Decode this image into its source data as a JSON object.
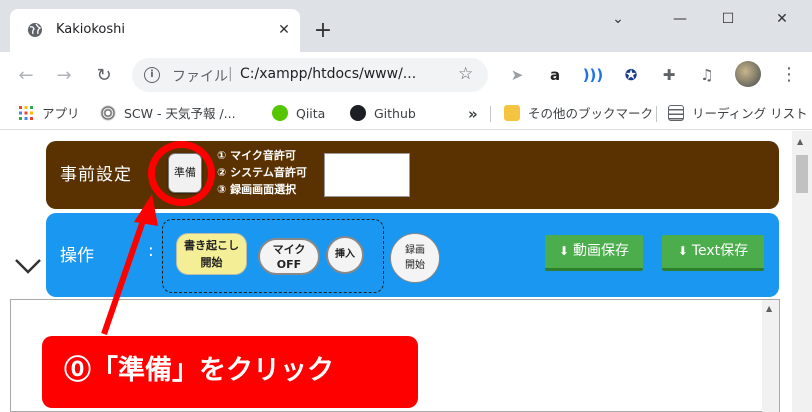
{
  "browser": {
    "tab_title": "Kakiokoshi",
    "tab_close": "✕",
    "new_tab": "+",
    "window_controls": [
      "⌄",
      "—",
      "☐",
      "✕"
    ],
    "omnibox": {
      "scheme_label": "ファイル",
      "separator": "|",
      "url": "C:/xampp/htdocs/www/..."
    },
    "bookmarks": [
      {
        "label": "アプリ",
        "icon": "apps-grid-icon"
      },
      {
        "label": "SCW - 天気予報 /...",
        "icon": "scw-icon"
      },
      {
        "label": "Qiita",
        "icon": "qiita-icon"
      },
      {
        "label": "Github",
        "icon": "github-icon"
      }
    ],
    "bookmarks_overflow": "»",
    "other_bookmarks": "その他のブックマーク",
    "reading_list": "リーディング リスト"
  },
  "app": {
    "setup": {
      "title": "事前設定",
      "prepare_button": "準備",
      "steps": [
        "① マイク音許可",
        "② システム音許可",
        "③ 録画画面選択"
      ]
    },
    "operations": {
      "title": "操作",
      "colon": ":",
      "transcribe_button": [
        "書き起こし",
        "開始"
      ],
      "mic_button": [
        "マイク",
        "OFF"
      ],
      "insert_button": "挿入",
      "record_button": [
        "録画",
        "開始"
      ],
      "save_video_button": "動画保存",
      "save_text_button": "Text保存"
    }
  },
  "annotation": {
    "callout_text": "⓪「準備」をクリック",
    "accent_color": "#ff0000"
  },
  "colors": {
    "setup_panel": "#5a3101",
    "operations_panel": "#1a97f0",
    "save_button": "#4cad4c",
    "transcribe_button": "#f4ef97"
  }
}
